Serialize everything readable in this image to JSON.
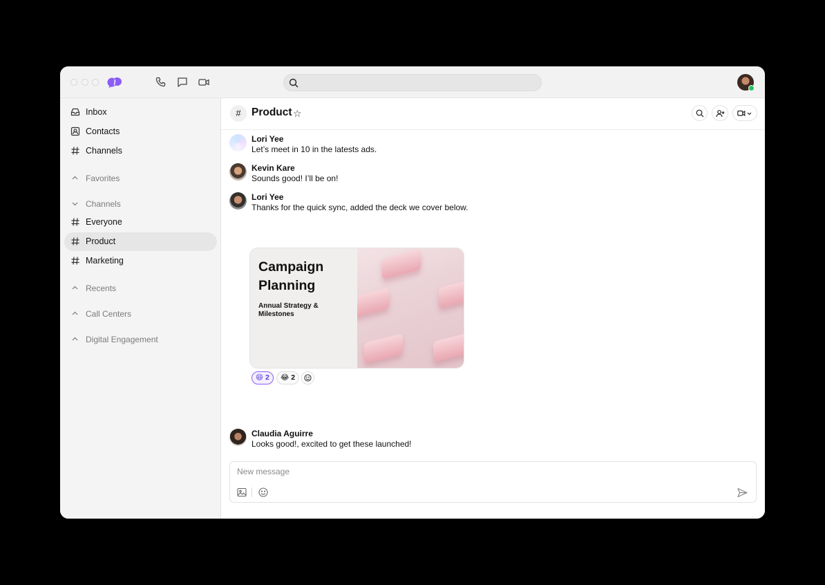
{
  "titlebar": {
    "icons": [
      "phone-icon",
      "chat-bubble-icon",
      "video-camera-icon"
    ],
    "search": {
      "placeholder": "",
      "value": ""
    },
    "status_color": "#22c55e",
    "brand_color": "#8b5cf6"
  },
  "sidebar": {
    "top_items": [
      {
        "label": "Inbox",
        "icon": "inbox-icon"
      },
      {
        "label": "Contacts",
        "icon": "contacts-icon"
      },
      {
        "label": "Channels",
        "icon": "hash-icon"
      }
    ],
    "sections": {
      "favorites": "Favorites",
      "channels": "Channels",
      "recents": "Recents",
      "call_centers": "Call Centers",
      "digital_engagement": "Digital Engagement"
    },
    "channel_items": [
      {
        "label": "Everyone",
        "active": false
      },
      {
        "label": "Product",
        "active": true
      },
      {
        "label": "Marketing",
        "active": false
      }
    ]
  },
  "channel": {
    "hash": "#",
    "title": "Product",
    "star": "☆"
  },
  "messages": [
    {
      "sender": "Lori Yee",
      "text": "Let’s meet in 10 in the latests ads."
    },
    {
      "sender": "Kevin Kare",
      "text": "Sounds good! I’ll be on!"
    },
    {
      "sender": "Lori Yee",
      "text": "Thanks for the quick sync, added the deck we cover below."
    },
    {
      "sender": "Claudia Aguirre",
      "text": "Looks good!, excited to get these launched!"
    }
  ],
  "attachment": {
    "title": "Campaign Planning",
    "subtitle": "Annual Strategy & Milestones"
  },
  "reactions": [
    {
      "emoji": "😄",
      "count": "2",
      "mine": true
    },
    {
      "emoji": "😂",
      "count": "2",
      "mine": false
    }
  ],
  "composer": {
    "placeholder": "New message"
  }
}
